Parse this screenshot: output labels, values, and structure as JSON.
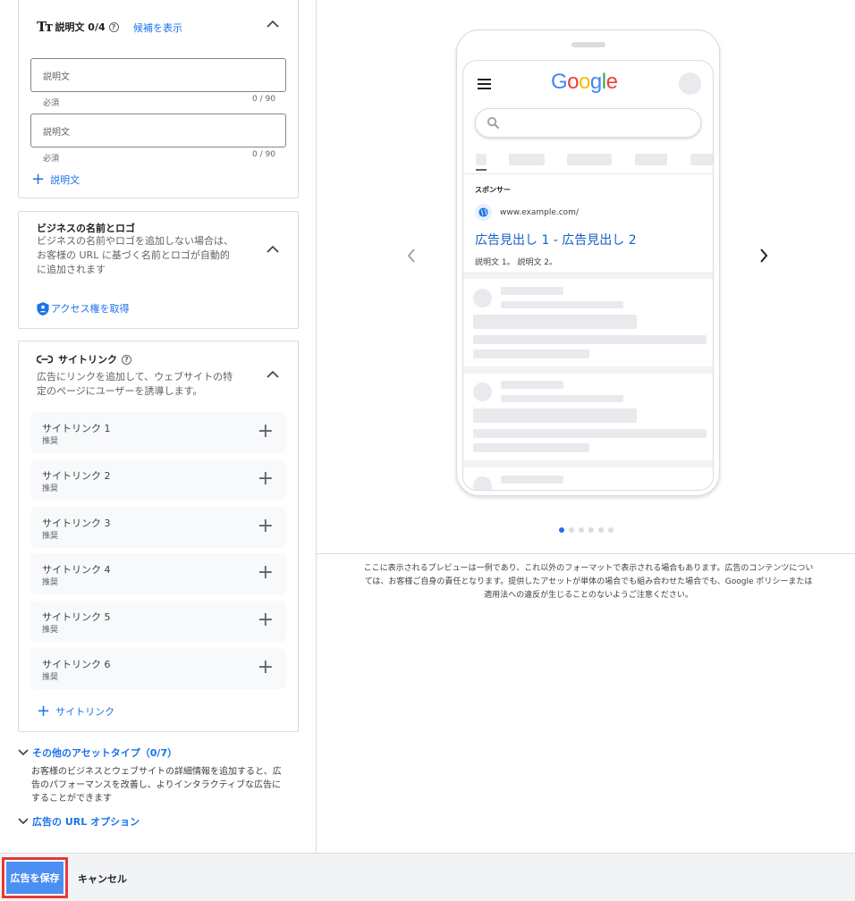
{
  "description_section": {
    "title": "説明文 0/4",
    "show_candidates": "候補を表示",
    "field1": {
      "placeholder": "説明文",
      "required": "必須",
      "counter": "0 / 90"
    },
    "field2": {
      "placeholder": "説明文",
      "required": "必須",
      "counter": "0 / 90"
    },
    "add_label": "説明文"
  },
  "business_section": {
    "title": "ビジネスの名前とロゴ",
    "desc_line1": "ビジネスの名前やロゴを追加しない場合は、",
    "desc_line2": "お客様の URL に基づく名前とロゴが自動的",
    "desc_line3": "に追加されます",
    "access_label": "アクセス権を取得"
  },
  "sitelink_section": {
    "title": "サイトリンク",
    "desc_line1": "広告にリンクを追加して、ウェブサイトの特",
    "desc_line2": "定のページにユーザーを誘導します。",
    "items": [
      {
        "name": "サイトリンク 1",
        "sub": "推奨"
      },
      {
        "name": "サイトリンク 2",
        "sub": "推奨"
      },
      {
        "name": "サイトリンク 3",
        "sub": "推奨"
      },
      {
        "name": "サイトリンク 4",
        "sub": "推奨"
      },
      {
        "name": "サイトリンク 5",
        "sub": "推奨"
      },
      {
        "name": "サイトリンク 6",
        "sub": "推奨"
      }
    ],
    "add_label": "サイトリンク"
  },
  "other_assets": {
    "title": "その他のアセットタイプ（0/7）",
    "desc_line1": "お客様のビジネスとウェブサイトの詳細情報を追加すると、広",
    "desc_line2": "告のパフォーマンスを改善し、よりインタラクティブな広告に",
    "desc_line3": "することができます"
  },
  "url_options": {
    "title": "広告の URL オプション"
  },
  "footer": {
    "save_label": "広告を保存",
    "cancel_label": "キャンセル"
  },
  "preview": {
    "logo": "Google",
    "sponsor": "スポンサー",
    "url": "www.example.com/",
    "headline": "広告見出し 1 - 広告見出し 2",
    "description": "説明文 1。 説明文 2。",
    "disclaimer_line1": "ここに表示されるプレビューは一例であり、これ以外のフォーマットで表示される場合もあります。広告のコンテンツについ",
    "disclaimer_line2": "ては、お客様ご自身の責任となります。提供したアセットが単体の場合でも組み合わせた場合でも、Google ポリシーまたは",
    "disclaimer_line3": "適用法への違反が生じることのないようご注意ください。",
    "page_dots": 6,
    "active_dot": 0
  },
  "colors": {
    "accent": "#1a73e8",
    "save_bg": "#4c8ff2",
    "highlight": "#e53935"
  }
}
